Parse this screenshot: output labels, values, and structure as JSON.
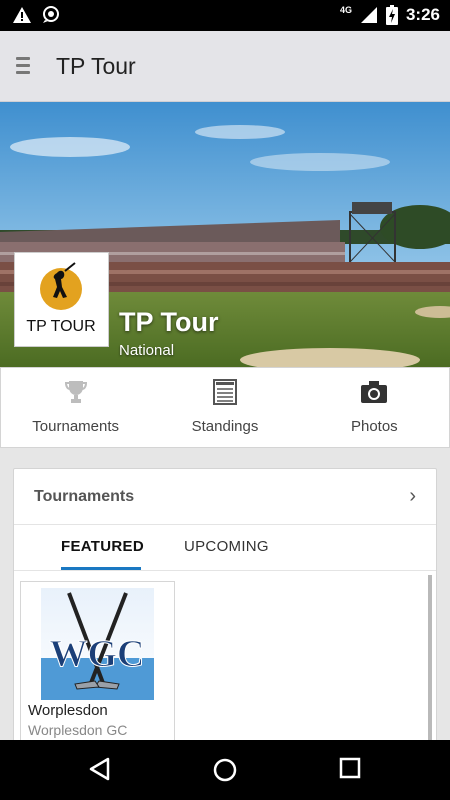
{
  "status_bar": {
    "time": "3:26",
    "network": "4G",
    "icons": [
      "warning-icon",
      "notification-icon",
      "signal-icon",
      "battery-icon"
    ]
  },
  "app_bar": {
    "title": "TP Tour",
    "menu_icon": "menu-icon"
  },
  "hero": {
    "title": "TP Tour",
    "subtitle": "National",
    "logo_text": "TP TOUR"
  },
  "quick_nav": [
    {
      "label": "Tournaments",
      "icon": "trophy-icon"
    },
    {
      "label": "Standings",
      "icon": "standings-icon"
    },
    {
      "label": "Photos",
      "icon": "camera-icon"
    }
  ],
  "tournaments_card": {
    "title": "Tournaments",
    "tabs": [
      {
        "label": "FEATURED",
        "active": true
      },
      {
        "label": "UPCOMING",
        "active": false
      }
    ],
    "items": [
      {
        "name": "Worplesdon",
        "club": "Worplesdon GC",
        "logo_text": "WGC"
      }
    ]
  },
  "colors": {
    "accent": "#1a78c2",
    "app_bar": "#e4e4e8",
    "background": "#e6e6e6"
  }
}
